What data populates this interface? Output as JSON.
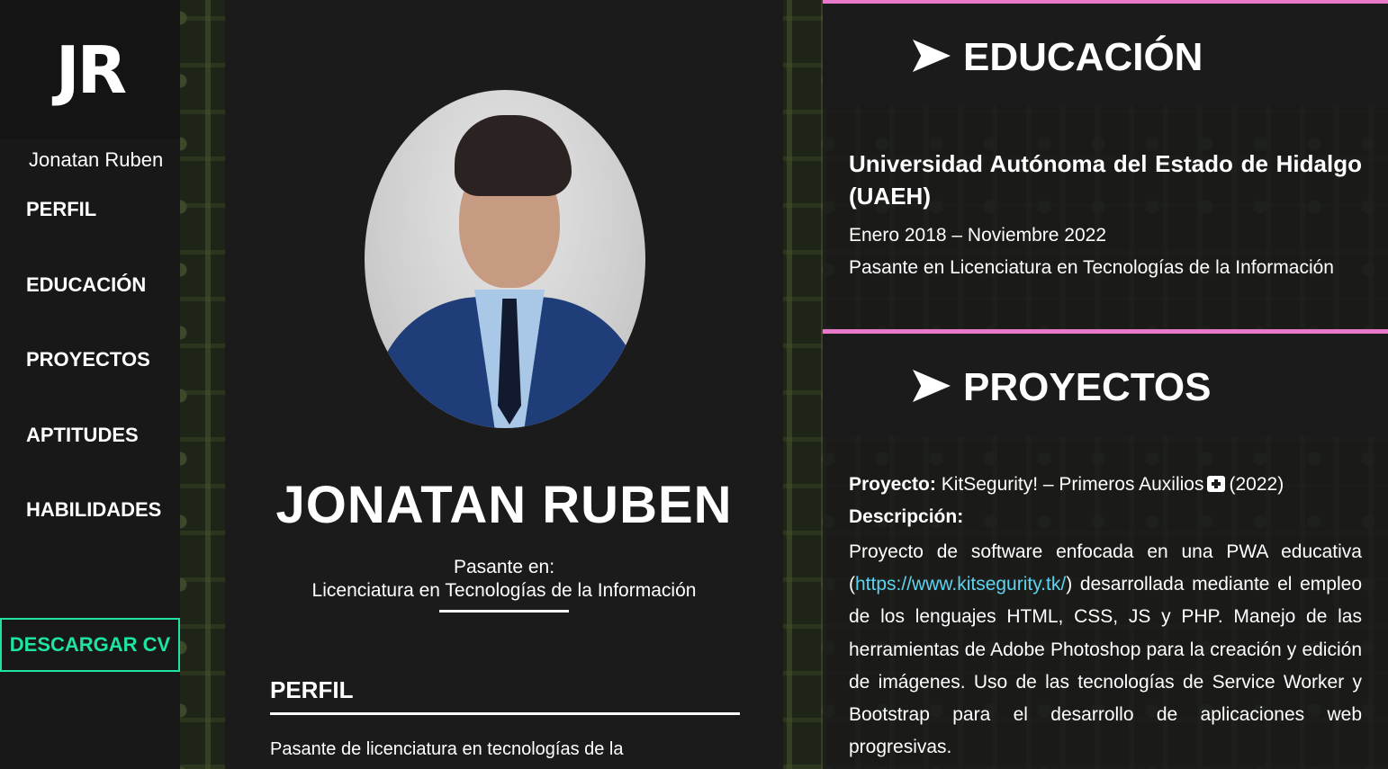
{
  "sidebar": {
    "logo": "JR",
    "name": "Jonatan Ruben",
    "nav": [
      "PERFIL",
      "EDUCACIÓN",
      "PROYECTOS",
      "APTITUDES",
      "HABILIDADES"
    ],
    "cv_button": "DESCARGAR CV"
  },
  "profile": {
    "name": "JONATAN RUBEN",
    "subtitle_line1": "Pasante en:",
    "subtitle_line2": "Licenciatura en Tecnologías de la Información",
    "perfil_heading": "PERFIL",
    "perfil_text": "Pasante de licenciatura en tecnologías de la"
  },
  "education": {
    "heading": "EDUCACIÓN",
    "institution": "Universidad Autónoma del Estado de Hidalgo (UAEH)",
    "dates": "Enero 2018 – Noviembre 2022",
    "degree": "Pasante en Licenciatura en Tecnologías de la Información"
  },
  "projects": {
    "heading": "PROYECTOS",
    "project_label": "Proyecto:",
    "project_name": "KitSegurity! – Primeros Auxilios",
    "project_year": "(2022)",
    "desc_label": "Descripción:",
    "desc_before": "Proyecto de software enfocada en una PWA educativa (",
    "link": "https://www.kitsegurity.tk/",
    "desc_after": ") desarrollada mediante el empleo de los lenguajes HTML, CSS, JS y PHP. Manejo de las herramientas de Adobe Photoshop para la creación y edición de imágenes. Uso de las tecnologías de Service Worker y Bootstrap para el desarrollo de aplicaciones web progresivas."
  },
  "colors": {
    "accent_green": "#1ee3a2",
    "accent_pink": "#e879c9",
    "link": "#5ed3f0",
    "panel": "#1b1b1b"
  },
  "icons": {
    "section_arrow": "arrow-right-icon",
    "project_icon": "first-aid-kit-icon"
  }
}
